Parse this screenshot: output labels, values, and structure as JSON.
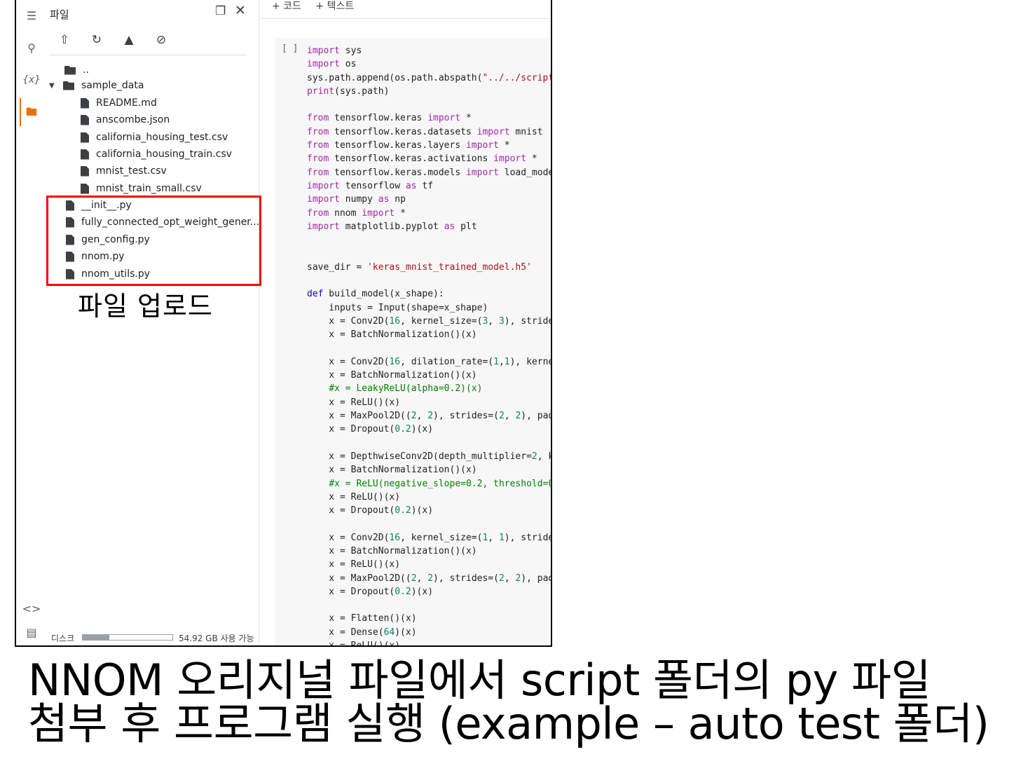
{
  "panel": {
    "title": "파일",
    "window_icon": "window-icon",
    "close_icon": "close-icon",
    "toolbar": [
      "upload-icon",
      "refresh-folder-icon",
      "drive-icon",
      "hide-icon"
    ],
    "tree": [
      {
        "name": "..",
        "kind": "folder-up"
      },
      {
        "name": "sample_data",
        "kind": "folder"
      },
      {
        "name": "README.md",
        "kind": "file",
        "indent": 2
      },
      {
        "name": "anscombe.json",
        "kind": "file",
        "indent": 2
      },
      {
        "name": "california_housing_test.csv",
        "kind": "file",
        "indent": 2
      },
      {
        "name": "california_housing_train.csv",
        "kind": "file",
        "indent": 2
      },
      {
        "name": "mnist_test.csv",
        "kind": "file",
        "indent": 2
      },
      {
        "name": "mnist_train_small.csv",
        "kind": "file",
        "indent": 2
      },
      {
        "name": "__init__.py",
        "kind": "file",
        "indent": 1
      },
      {
        "name": "fully_connected_opt_weight_gener...",
        "kind": "file",
        "indent": 1
      },
      {
        "name": "gen_config.py",
        "kind": "file",
        "indent": 1
      },
      {
        "name": "nnom.py",
        "kind": "file",
        "indent": 1
      },
      {
        "name": "nnom_utils.py",
        "kind": "file",
        "indent": 1
      }
    ],
    "upload_annotation": "파일 업로드",
    "disk_label": "디스크",
    "disk_used_fraction": 0.3,
    "disk_free": "54.92 GB 사용 가능"
  },
  "editor": {
    "add_code": "+ 코드",
    "add_text": "+ 텍스트",
    "run_bracket": "[ ]"
  },
  "caption": {
    "line1": "NNOM 오리지널 파일에서 script 폴더의 py 파일",
    "line2": "첨부 후 프로그램 실행 (example – auto test 폴더)"
  }
}
